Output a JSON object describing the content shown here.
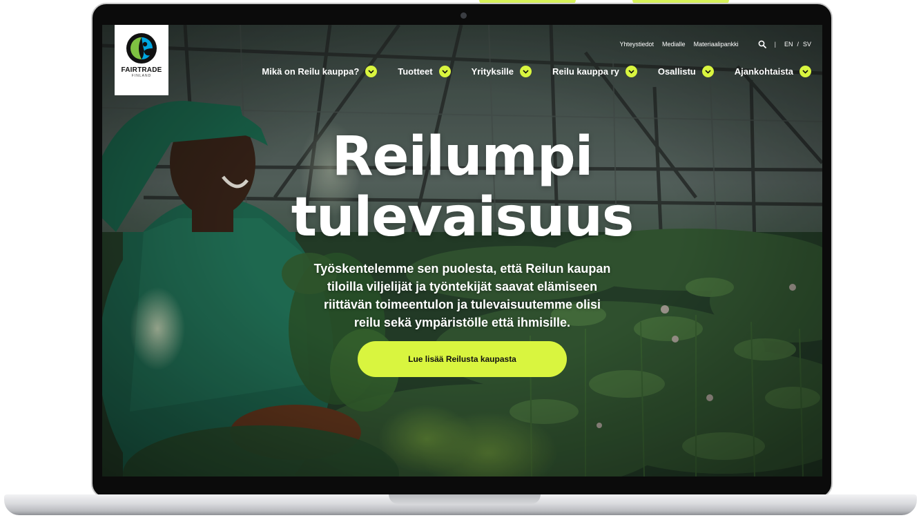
{
  "brand": {
    "name": "FAIRTRADE",
    "sub": "FINLAND",
    "accent": "#d9f53f"
  },
  "utility_nav": {
    "links": [
      "Yhteystiedot",
      "Medialle",
      "Materiaalipankki"
    ],
    "search_icon": "search-icon",
    "languages": [
      "EN",
      "SV"
    ]
  },
  "main_nav": {
    "items": [
      "Mikä on Reilu kauppa?",
      "Tuotteet",
      "Yrityksille",
      "Reilu kauppa ry",
      "Osallistu",
      "Ajankohtaista"
    ],
    "chevron_icon": "chevron-down-icon"
  },
  "hero": {
    "title_line1": "Reilumpi",
    "title_line2": "tulevaisuus",
    "text_lines": [
      "Työskentelemme sen puolesta, että Reilun kaupan",
      "tiloilla viljelijät ja työntekijät saavat elämiseen",
      "riittävän toimeentulon ja tulevaisuutemme olisi",
      "reilu sekä ympäristölle että ihmisille."
    ],
    "cta_label": "Lue lisää Reilusta kaupasta"
  }
}
